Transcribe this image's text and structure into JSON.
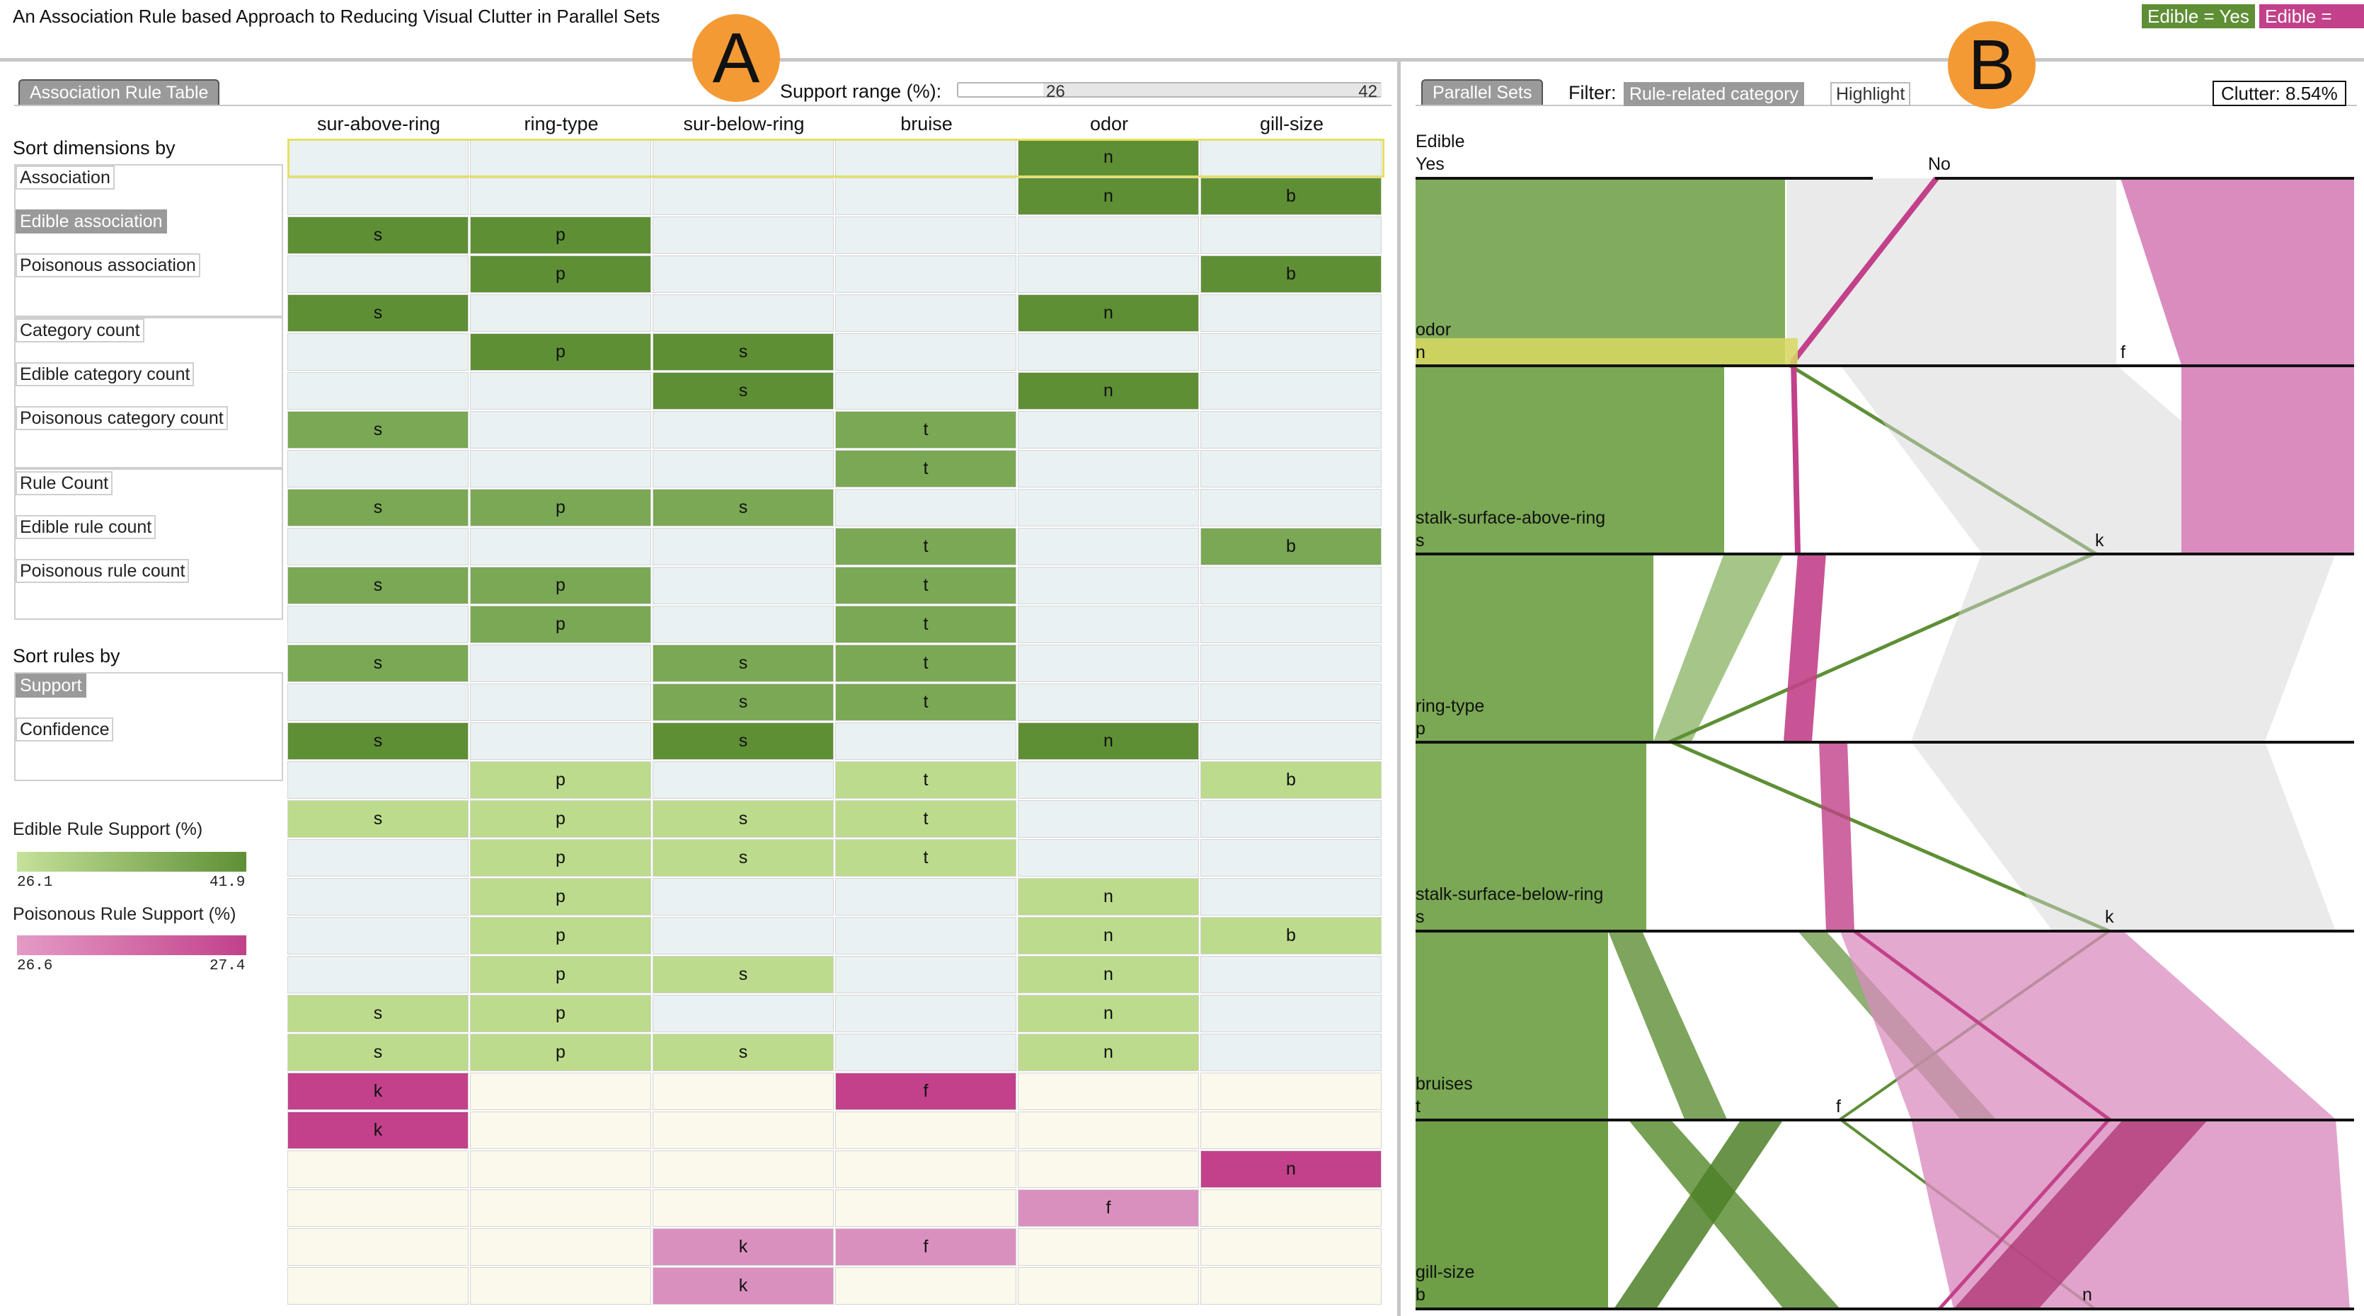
{
  "header": {
    "title": "An Association Rule based Approach to Reducing Visual Clutter in Parallel Sets",
    "legend": [
      {
        "label": "Edible = Yes",
        "color": "#5e8f35"
      },
      {
        "label": "Edible = No",
        "color": "#c2418a"
      }
    ]
  },
  "badges": {
    "a": "A",
    "b": "B"
  },
  "rule_table": {
    "tab_label": "Association Rule Table",
    "support_label": "Support range (%):",
    "support_min": "26",
    "support_max": "42",
    "columns": [
      "sur-above-ring",
      "ring-type",
      "sur-below-ring",
      "bruise",
      "odor",
      "gill-size"
    ],
    "rows": [
      {
        "class": "edible",
        "cells": [
          "",
          "",
          "",
          "",
          "n",
          ""
        ]
      },
      {
        "class": "edible",
        "cells": [
          "",
          "",
          "",
          "",
          "n",
          "b"
        ]
      },
      {
        "class": "edible",
        "cells": [
          "s",
          "p",
          "",
          "",
          "",
          ""
        ]
      },
      {
        "class": "edible",
        "cells": [
          "",
          "p",
          "",
          "",
          "",
          "b"
        ]
      },
      {
        "class": "edible",
        "cells": [
          "s",
          "",
          "",
          "",
          "n",
          ""
        ]
      },
      {
        "class": "edible",
        "cells": [
          "",
          "p",
          "s",
          "",
          "",
          ""
        ]
      },
      {
        "class": "edible",
        "cells": [
          "",
          "",
          "s",
          "",
          "n",
          ""
        ]
      },
      {
        "class": "edible",
        "cells": [
          "s",
          "",
          "",
          "t",
          "",
          ""
        ]
      },
      {
        "class": "edible",
        "cells": [
          "",
          "",
          "",
          "t",
          "",
          ""
        ]
      },
      {
        "class": "edible",
        "cells": [
          "s",
          "p",
          "s",
          "",
          "",
          ""
        ]
      },
      {
        "class": "edible",
        "cells": [
          "",
          "",
          "",
          "t",
          "",
          "b"
        ]
      },
      {
        "class": "edible",
        "cells": [
          "s",
          "p",
          "",
          "t",
          "",
          ""
        ]
      },
      {
        "class": "edible",
        "cells": [
          "",
          "p",
          "",
          "t",
          "",
          ""
        ]
      },
      {
        "class": "edible",
        "cells": [
          "s",
          "",
          "s",
          "t",
          "",
          ""
        ]
      },
      {
        "class": "edible",
        "cells": [
          "",
          "",
          "s",
          "t",
          "",
          ""
        ]
      },
      {
        "class": "edible",
        "cells": [
          "s",
          "",
          "s",
          "",
          "n",
          ""
        ]
      },
      {
        "class": "edible",
        "cells": [
          "",
          "p",
          "",
          "t",
          "",
          "b"
        ]
      },
      {
        "class": "edible",
        "cells": [
          "s",
          "p",
          "s",
          "t",
          "",
          ""
        ]
      },
      {
        "class": "edible",
        "cells": [
          "",
          "p",
          "s",
          "t",
          "",
          ""
        ]
      },
      {
        "class": "edible",
        "cells": [
          "",
          "p",
          "",
          "",
          "n",
          ""
        ]
      },
      {
        "class": "edible",
        "cells": [
          "",
          "p",
          "",
          "",
          "n",
          "b"
        ]
      },
      {
        "class": "edible",
        "cells": [
          "",
          "p",
          "s",
          "",
          "n",
          ""
        ]
      },
      {
        "class": "edible",
        "cells": [
          "s",
          "p",
          "",
          "",
          "n",
          ""
        ]
      },
      {
        "class": "edible",
        "cells": [
          "s",
          "p",
          "s",
          "",
          "n",
          ""
        ]
      },
      {
        "class": "poisonous",
        "cells": [
          "k",
          "",
          "",
          "f",
          "",
          ""
        ]
      },
      {
        "class": "poisonous",
        "cells": [
          "k",
          "",
          "",
          "",
          "",
          ""
        ]
      },
      {
        "class": "poisonous",
        "cells": [
          "",
          "",
          "",
          "",
          "",
          "n"
        ]
      },
      {
        "class": "poisonous",
        "cells": [
          "",
          "",
          "",
          "",
          "f",
          ""
        ]
      },
      {
        "class": "poisonous",
        "cells": [
          "",
          "",
          "k",
          "f",
          "",
          ""
        ]
      },
      {
        "class": "poisonous",
        "cells": [
          "",
          "",
          "k",
          "",
          "",
          ""
        ]
      }
    ],
    "colors": {
      "edible_dark": "#5e8f35",
      "edible_mid": "#7aa854",
      "edible_light": "#bcdb8c",
      "poison_dark": "#c2418a",
      "poison_light": "#da90bf",
      "edible_row_bg": "#e9f1f3",
      "poison_row_bg": "#fbf8ec"
    }
  },
  "sidebar": {
    "sort_dimensions_label": "Sort dimensions by",
    "dimension_groups": [
      [
        "Association",
        "Edible association",
        "Poisonous association"
      ],
      [
        "Category count",
        "Edible category count",
        "Poisonous category count"
      ],
      [
        "Rule Count",
        "Edible rule count",
        "Poisonous rule count"
      ]
    ],
    "active_dimension": "Edible association",
    "sort_rules_label": "Sort rules by",
    "rule_sort_options": [
      "Support",
      "Confidence"
    ],
    "active_rule_sort": "Support",
    "edible_scale": {
      "title": "Edible Rule Support (%)",
      "min": "26.1",
      "max": "41.9"
    },
    "poison_scale": {
      "title": "Poisonous Rule Support (%)",
      "min": "26.6",
      "max": "27.4"
    }
  },
  "parallel_sets": {
    "tab_label": "Parallel Sets",
    "filter_label": "Filter:",
    "filter_rule": "Rule-related category",
    "filter_highlight": "Highlight",
    "clutter": "Clutter: 8.54%",
    "axes": [
      {
        "name": "Edible",
        "left_cat": "Yes",
        "right_cat": "No"
      },
      {
        "name": "odor",
        "left_cat": "n",
        "right_cat": "f"
      },
      {
        "name": "stalk-surface-above-ring",
        "left_cat": "s",
        "right_cat": "k"
      },
      {
        "name": "ring-type",
        "left_cat": "p",
        "right_cat": ""
      },
      {
        "name": "stalk-surface-below-ring",
        "left_cat": "s",
        "right_cat": "k"
      },
      {
        "name": "bruises",
        "left_cat": "t",
        "right_cat": "f"
      },
      {
        "name": "gill-size",
        "left_cat": "b",
        "right_cat": "n"
      }
    ]
  }
}
